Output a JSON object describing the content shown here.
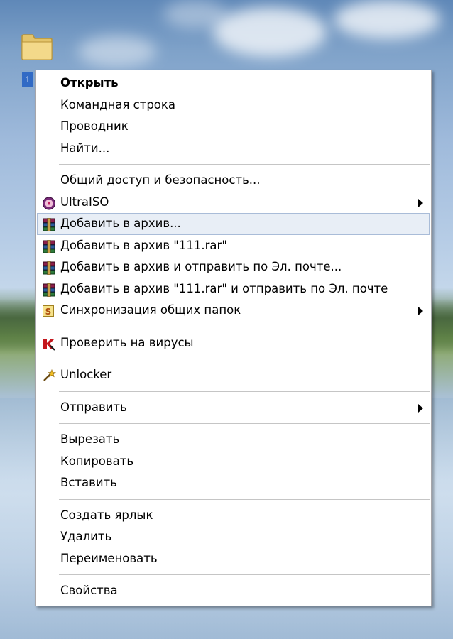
{
  "desktop": {
    "folder": {
      "label": "1",
      "icon": "folder-icon"
    }
  },
  "menu": {
    "groups": [
      {
        "items": [
          {
            "label": "Открыть",
            "bold": true
          },
          {
            "label": "Командная строка"
          },
          {
            "label": "Проводник"
          },
          {
            "label": "Найти..."
          }
        ]
      },
      {
        "items": [
          {
            "label": "Общий доступ и безопасность..."
          },
          {
            "label": "UltraISO",
            "icon": "ultraiso-icon",
            "submenu": true
          },
          {
            "label": "Добавить в архив...",
            "icon": "winrar-icon",
            "highlighted": true
          },
          {
            "label": "Добавить в архив \"111.rar\"",
            "icon": "winrar-icon"
          },
          {
            "label": "Добавить в архив и отправить по Эл. почте...",
            "icon": "winrar-icon"
          },
          {
            "label": "Добавить в архив \"111.rar\" и отправить по Эл. почте",
            "icon": "winrar-icon"
          },
          {
            "label": "Синхронизация общих папок",
            "icon": "sync-icon",
            "submenu": true
          }
        ]
      },
      {
        "items": [
          {
            "label": "Проверить на вирусы",
            "icon": "kaspersky-icon"
          }
        ]
      },
      {
        "items": [
          {
            "label": "Unlocker",
            "icon": "unlocker-wand-icon"
          }
        ]
      },
      {
        "items": [
          {
            "label": "Отправить",
            "submenu": true
          }
        ]
      },
      {
        "items": [
          {
            "label": "Вырезать"
          },
          {
            "label": "Копировать"
          },
          {
            "label": "Вставить"
          }
        ]
      },
      {
        "items": [
          {
            "label": "Создать ярлык"
          },
          {
            "label": "Удалить"
          },
          {
            "label": "Переименовать"
          }
        ]
      },
      {
        "items": [
          {
            "label": "Свойства"
          }
        ]
      }
    ]
  },
  "colors": {
    "highlight_bg": "#e8eef6",
    "highlight_border": "#a9bcd8",
    "separator": "#c5c5c5",
    "selection": "#316ac5"
  }
}
